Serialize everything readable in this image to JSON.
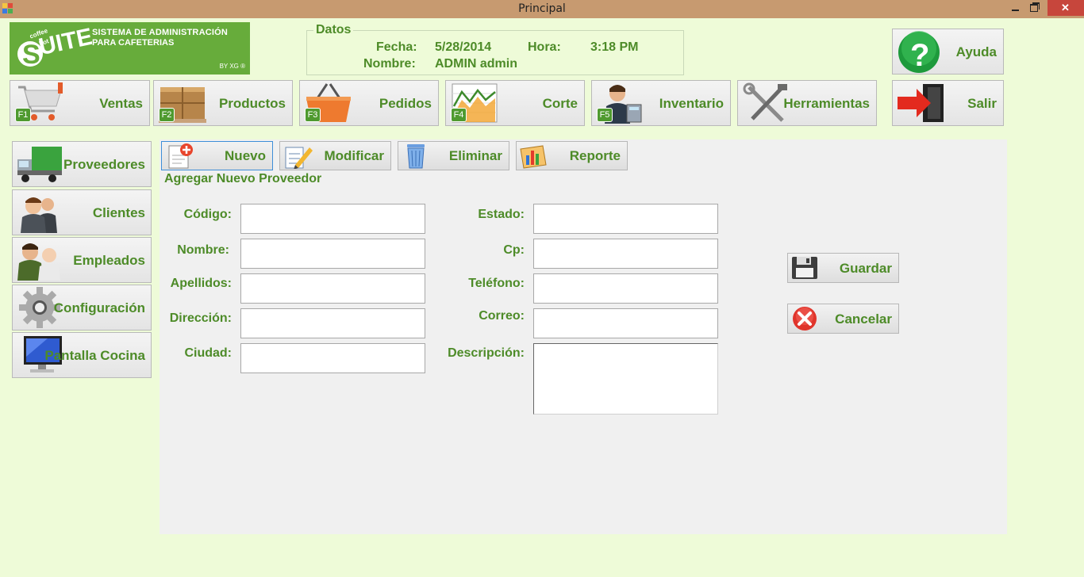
{
  "window": {
    "title": "Principal"
  },
  "logo": {
    "brand": "SUITE",
    "brand_sub": "coffee hot",
    "line1": "SISTEMA DE ADMINISTRACIÓN",
    "line2": "PARA CAFETERIAS",
    "by": "BY XG ®"
  },
  "datos": {
    "legend": "Datos",
    "fecha_label": "Fecha:",
    "fecha_value": "5/28/2014",
    "hora_label": "Hora:",
    "hora_value": "3:18 PM",
    "nombre_label": "Nombre:",
    "nombre_value": "ADMIN admin"
  },
  "toolbar": {
    "ventas": {
      "label": "Ventas",
      "key": "F1"
    },
    "productos": {
      "label": "Productos",
      "key": "F2"
    },
    "pedidos": {
      "label": "Pedidos",
      "key": "F3"
    },
    "corte": {
      "label": "Corte",
      "key": "F4"
    },
    "inventario": {
      "label": "Inventario",
      "key": "F5"
    },
    "herramientas": {
      "label": "Herramientas"
    },
    "ayuda": {
      "label": "Ayuda"
    },
    "salir": {
      "label": "Salir"
    }
  },
  "sidebar": {
    "proveedores": "Proveedores",
    "clientes": "Clientes",
    "empleados": "Empleados",
    "configuracion": "Configuración",
    "pantalla_cocina": "Pantalla Cocina"
  },
  "actions": {
    "nuevo": "Nuevo",
    "modificar": "Modificar",
    "eliminar": "Eliminar",
    "reporte": "Reporte"
  },
  "form": {
    "title": "Agregar Nuevo Proveedor",
    "codigo": {
      "label": "Código:",
      "value": ""
    },
    "nombre": {
      "label": "Nombre:",
      "value": ""
    },
    "apellidos": {
      "label": "Apellidos:",
      "value": ""
    },
    "direccion": {
      "label": "Dirección:",
      "value": ""
    },
    "ciudad": {
      "label": "Ciudad:",
      "value": ""
    },
    "estado": {
      "label": "Estado:",
      "value": ""
    },
    "cp": {
      "label": "Cp:",
      "value": ""
    },
    "telefono": {
      "label": "Teléfono:",
      "value": ""
    },
    "correo": {
      "label": "Correo:",
      "value": ""
    },
    "descripcion": {
      "label": "Descripción:",
      "value": ""
    },
    "guardar": "Guardar",
    "cancelar": "Cancelar"
  },
  "colors": {
    "background": "#eefbd8",
    "accent_green": "#4d8b28",
    "title_bar": "#c79a70",
    "close_button": "#c7463c",
    "panel": "#f0f0f0"
  }
}
